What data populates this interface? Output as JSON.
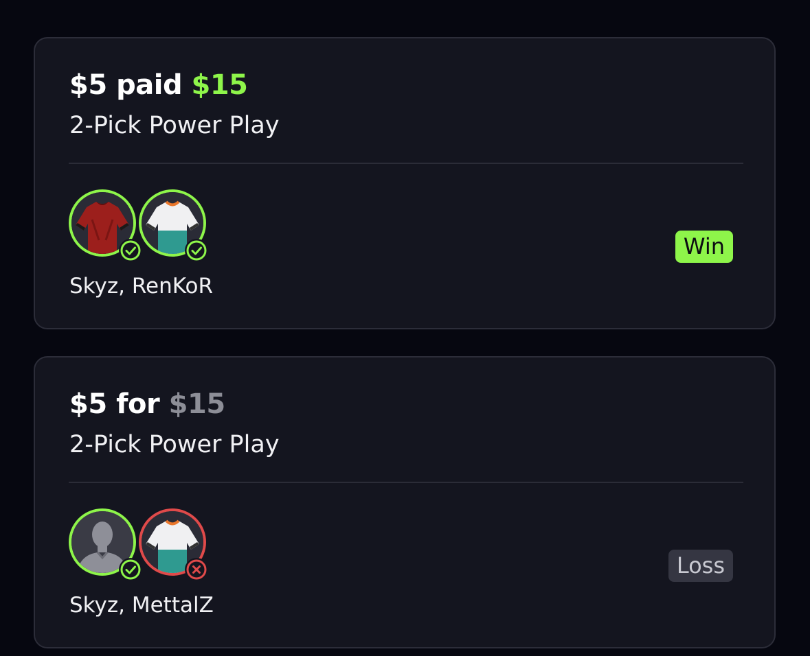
{
  "entries": [
    {
      "stake": "$5",
      "connector": "paid",
      "amount": "$15",
      "play_type": "2-Pick Power Play",
      "players": "Skyz, RenKoR",
      "result": "Win",
      "picks": [
        {
          "avatar": "red-jersey-icon",
          "status": "check-icon"
        },
        {
          "avatar": "white-teal-jersey-icon",
          "status": "check-icon"
        }
      ]
    },
    {
      "stake": "$5",
      "connector": "for",
      "amount": "$15",
      "play_type": "2-Pick Power Play",
      "players": "Skyz, MettalZ",
      "result": "Loss",
      "picks": [
        {
          "avatar": "player-silhouette-icon",
          "status": "check-icon"
        },
        {
          "avatar": "white-teal-jersey-icon",
          "status": "x-icon"
        }
      ]
    }
  ],
  "colors": {
    "win_green": "#8ef54a",
    "loss_red": "#e04a4a",
    "card_bg": "#14151f",
    "muted_amount": "#8d8e97"
  }
}
